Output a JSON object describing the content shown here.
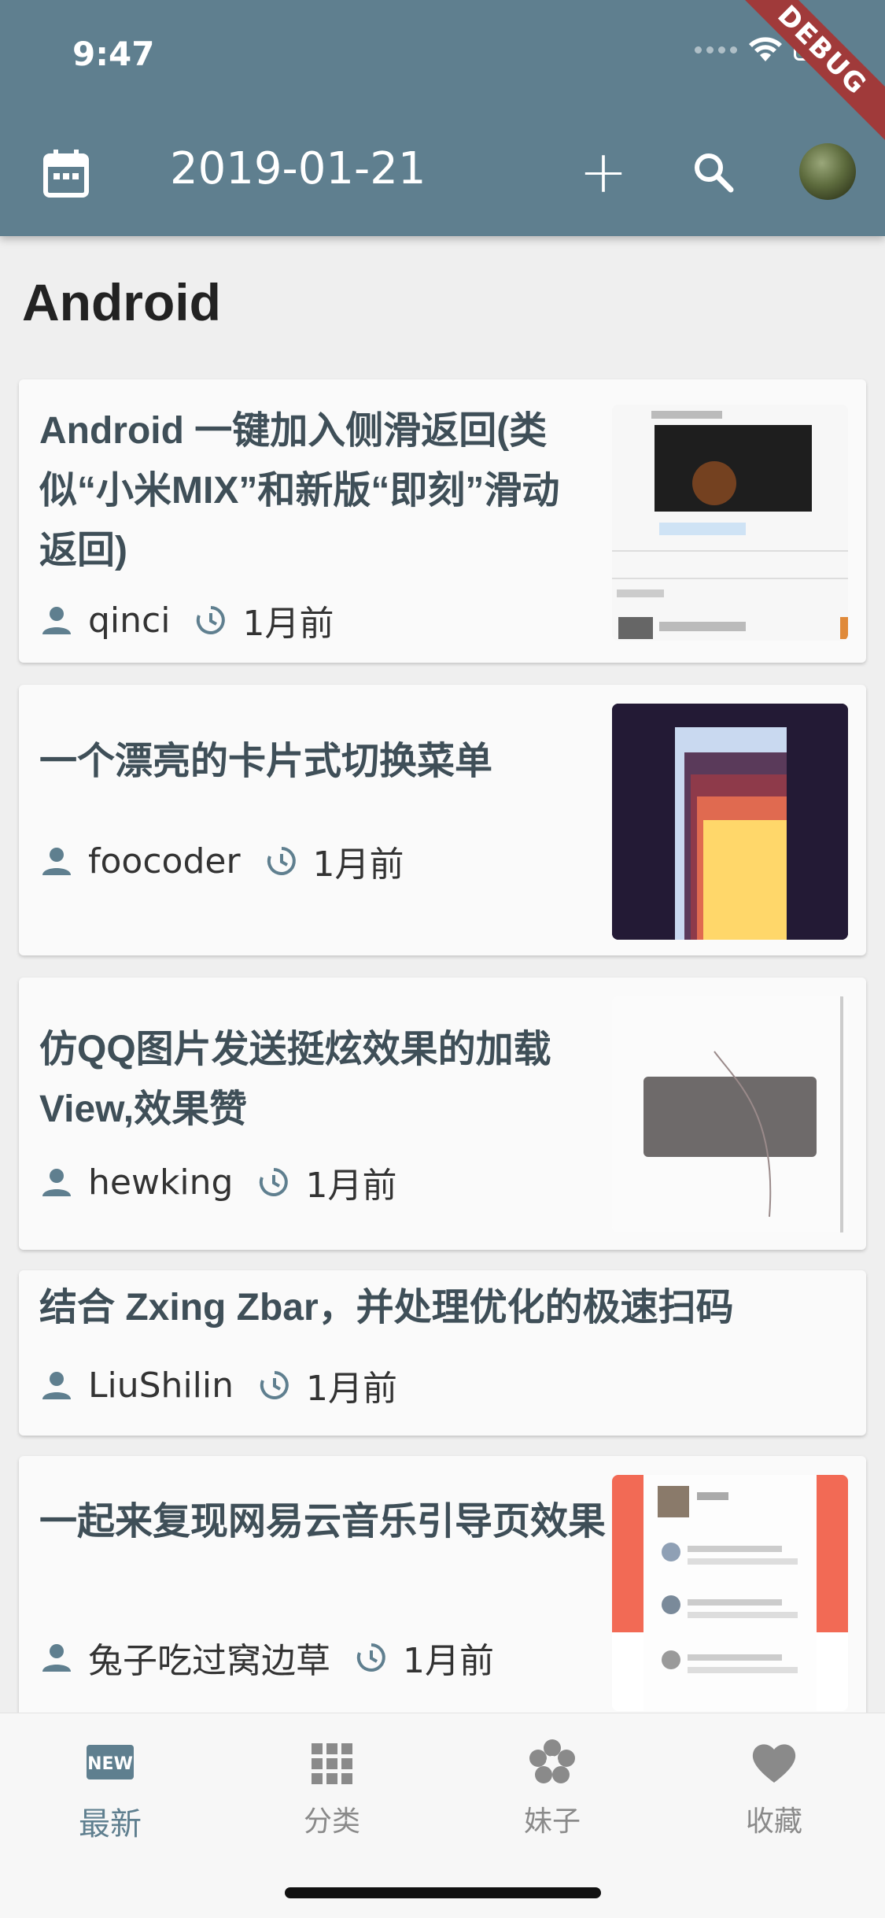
{
  "status_bar": {
    "time": "9:47",
    "debug_label": "DEBUG"
  },
  "app_bar": {
    "title": "2019-01-21",
    "add_label": "+"
  },
  "section": {
    "title": "Android"
  },
  "items": [
    {
      "title": "Android 一键加入侧滑返回(类似“小米MIX”和新版“即刻”滑动返回)",
      "author": "qinci",
      "time": "1月前"
    },
    {
      "title": "一个漂亮的卡片式切换菜单",
      "author": "foocoder",
      "time": "1月前"
    },
    {
      "title": "仿QQ图片发送挺炫效果的加载View,效果赞",
      "author": "hewking",
      "time": "1月前"
    },
    {
      "title": "结合 Zxing Zbar，并处理优化的极速扫码",
      "author": "LiuShilin",
      "time": "1月前"
    },
    {
      "title": "一起来复现网易云音乐引导页效果",
      "author": "兔子吃过窝边草",
      "time": "1月前"
    }
  ],
  "bottom_nav": [
    {
      "label": "最新",
      "icon": "new-badge-icon"
    },
    {
      "label": "分类",
      "icon": "grid-icon"
    },
    {
      "label": "妹子",
      "icon": "flower-icon"
    },
    {
      "label": "收藏",
      "icon": "heart-icon"
    }
  ],
  "colors": {
    "primary": "#5f7f8f",
    "background": "#efefef",
    "card": "#fafafa",
    "title_text": "#3f4f58"
  }
}
